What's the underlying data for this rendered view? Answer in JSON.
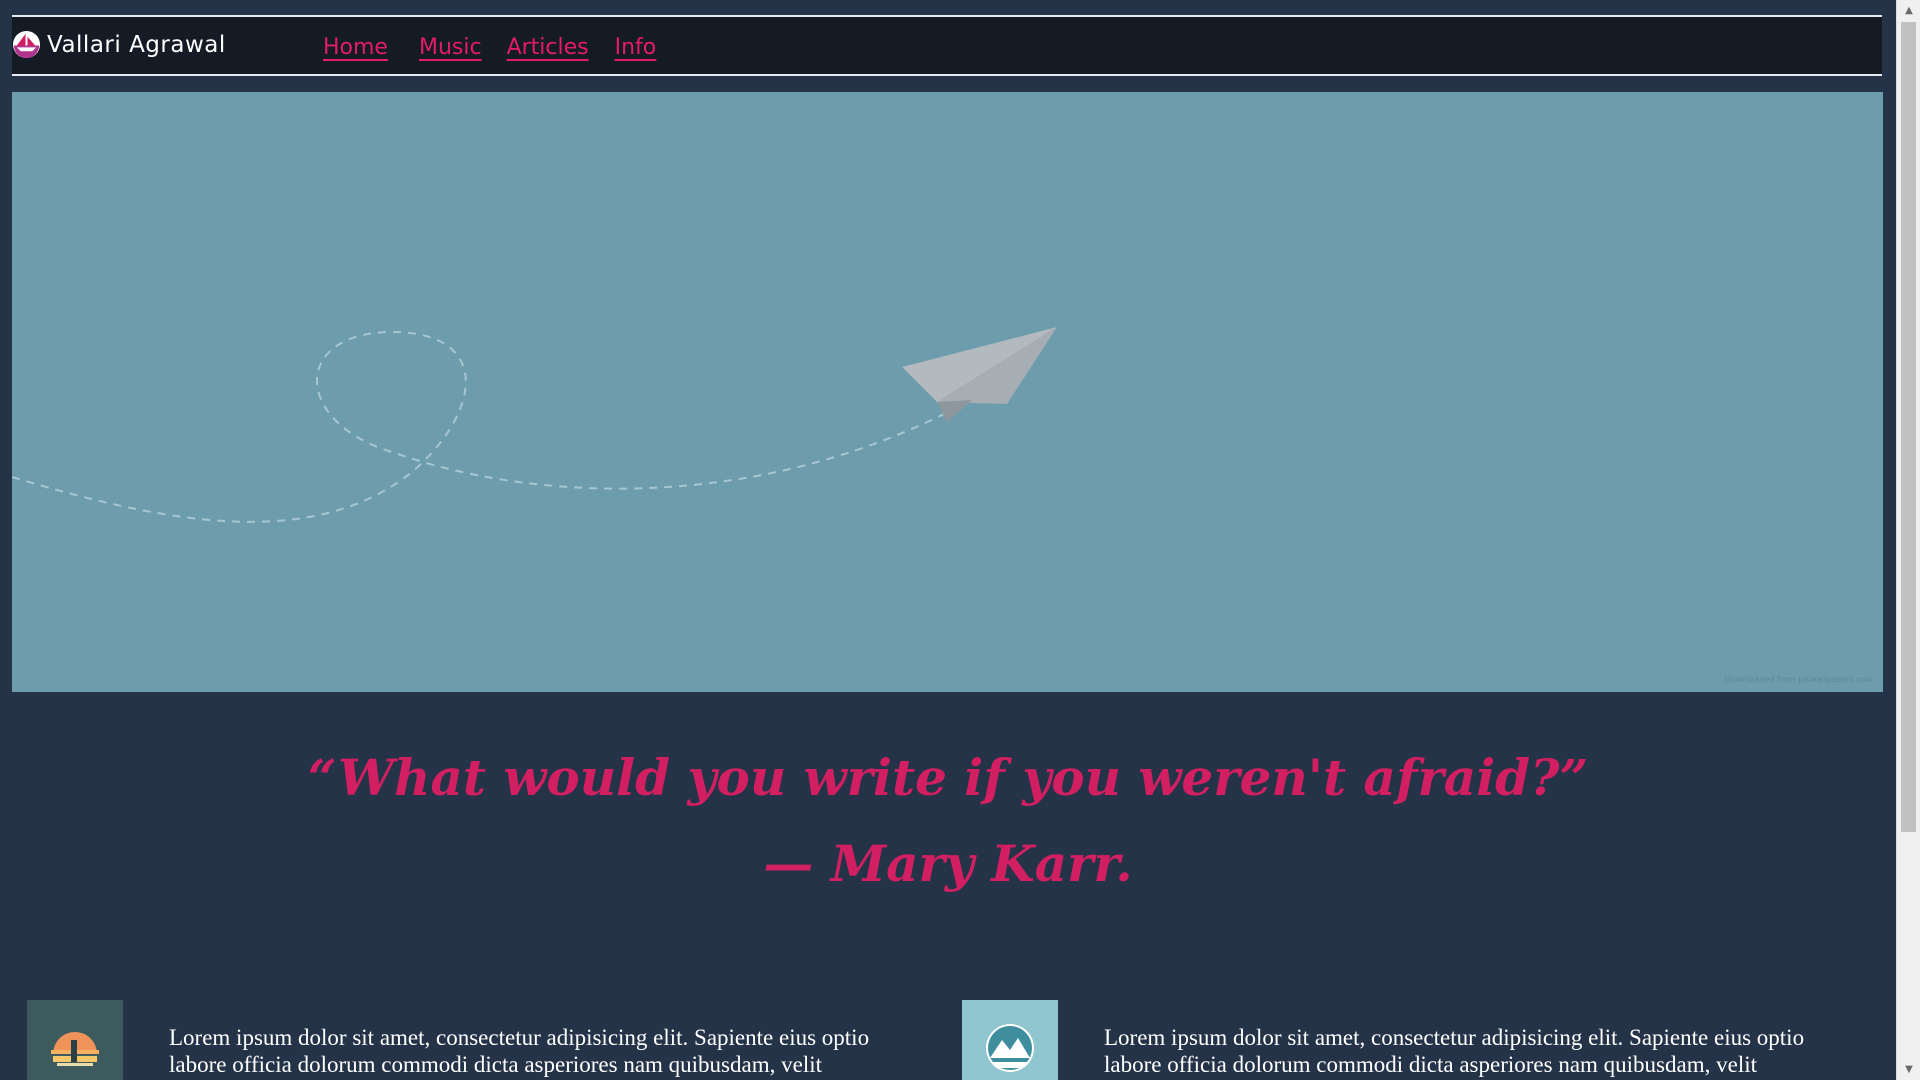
{
  "brand": {
    "name": "Vallari Agrawal"
  },
  "nav": {
    "links": [
      "Home",
      "Music",
      "Articles",
      "Info"
    ]
  },
  "hero": {
    "colors": {
      "background": "#6d9dad",
      "plane": "#a9b1b8"
    }
  },
  "quote": {
    "text": "“What would you write if you weren't afraid?”",
    "author": "— Mary Karr."
  },
  "cards": [
    {
      "thumb_icon": "sunset-island-icon",
      "text": "Lorem ipsum dolor sit amet, consectetur adipisicing elit. Sapiente eius optio labore officia dolorum commodi dicta asperiores nam quibusdam, velit"
    },
    {
      "thumb_icon": "mountain-badge-icon",
      "text": "Lorem ipsum dolor sit amet, consectetur adipisicing elit. Sapiente eius optio labore officia dolorum commodi dicta asperiores nam quibusdam, velit"
    }
  ],
  "colors": {
    "page_bg": "#243347",
    "nav_bg": "#141b25",
    "accent": "#e51a6a",
    "quote": "#d21f62"
  }
}
